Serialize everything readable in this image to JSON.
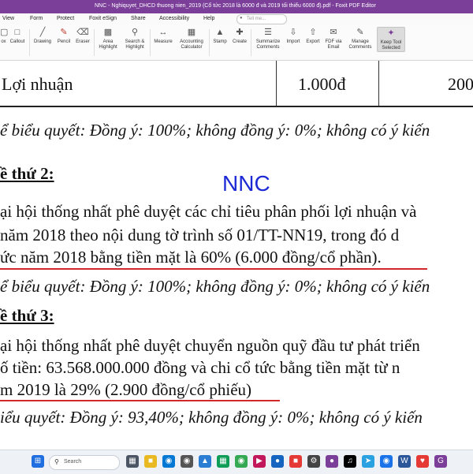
{
  "titlebar": {
    "title": "NNC - Nghiquyet_DHCD thuong nien_2019 (Cổ tức 2018 là 6000 đ và 2019 tối thiểu 6000 đ).pdf - Foxit PDF Editor"
  },
  "menu": {
    "items": [
      "View",
      "Form",
      "Protect",
      "Foxit eSign",
      "Share",
      "Accessibility",
      "Help"
    ],
    "tell_me": "Tell me..."
  },
  "ribbon": {
    "buttons": [
      {
        "label": "ox",
        "icon": "textbox-icon"
      },
      {
        "label": "Callout",
        "icon": "callout-icon"
      },
      {
        "label": "Drawing",
        "icon": "drawing-icon"
      },
      {
        "label": "Pencil",
        "icon": "pencil-icon"
      },
      {
        "label": "Eraser",
        "icon": "eraser-icon"
      },
      {
        "label": "Area\nHighlight",
        "icon": "area-highlight-icon"
      },
      {
        "label": "Search &\nHighlight",
        "icon": "search-highlight-icon"
      },
      {
        "label": "Measure",
        "icon": "measure-icon"
      },
      {
        "label": "Accounting\nCalculator",
        "icon": "calculator-icon"
      },
      {
        "label": "Stamp",
        "icon": "stamp-icon"
      },
      {
        "label": "Create",
        "icon": "create-icon"
      },
      {
        "label": "Summarize\nComments",
        "icon": "summarize-icon"
      },
      {
        "label": "Import",
        "icon": "import-icon"
      },
      {
        "label": "Export",
        "icon": "export-icon"
      },
      {
        "label": "FDF via\nEmail",
        "icon": "fdf-email-icon"
      },
      {
        "label": "Manage\nComments",
        "icon": "manage-comments-icon"
      },
      {
        "label": "Keep Tool\nSelected",
        "icon": "pin-icon"
      }
    ]
  },
  "document": {
    "table_row": {
      "label": "Lợi nhuận",
      "value": "1.000đ",
      "next": "200"
    },
    "vote1": "ể biểu quyết: Đồng ý: 100%; không đồng ý: 0%; không có ý kiến",
    "heading2": "ề thứ 2:",
    "watermark": "NNC",
    "p2_line1": "ại hội thống nhất phê duyệt các chỉ tiêu phân phối lợi nhuận và",
    "p2_line2": "năm 2018 theo nội dung tờ trình số 01/TT-NN19, trong đó d",
    "p2_line3": "ức năm 2018 bằng tiền mặt là 60% (6.000 đồng/cổ phần).",
    "vote2": "ể biểu quyết: Đồng ý: 100%; không đồng ý: 0%; không có ý kiến",
    "heading3": "ề thứ 3:",
    "p3_line1": "ại hội thống nhất phê duyệt chuyển nguồn quỹ đầu tư phát triển",
    "p3_line2": "ố tiền: 63.568.000.000 đồng và chi cổ tức bằng tiền mặt từ n",
    "p3_line3": "m 2019 là 29% (2.900 đồng/cổ phiếu)",
    "vote3": "iểu quyết: Đồng ý: 93,40%; không đồng ý: 0%; không có ý kiến"
  },
  "taskbar": {
    "search_placeholder": "Search",
    "accent": "#d2272d"
  }
}
